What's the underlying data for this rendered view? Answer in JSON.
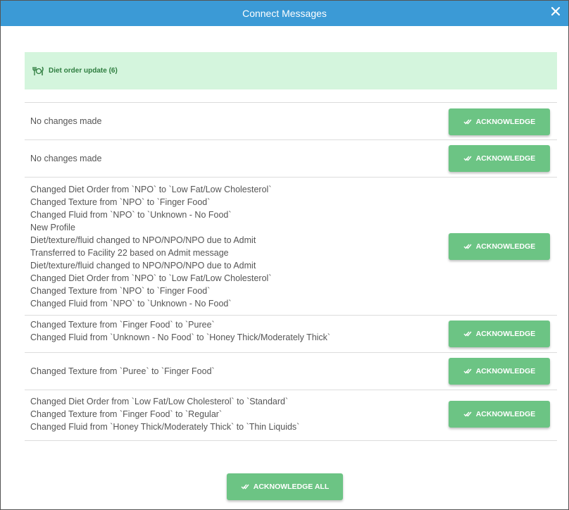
{
  "window": {
    "title": "Connect Messages",
    "close_icon": "close-icon"
  },
  "banner": {
    "icon": "utensils-icon",
    "text": "Diet order update (6)"
  },
  "ack_label": "ACKNOWLEDGE",
  "ack_all_label": "ACKNOWLEDGE ALL",
  "colors": {
    "titlebar": "#3b9ad6",
    "banner_bg": "#d4f5dd",
    "button": "#6cc484"
  },
  "messages": [
    {
      "lines": [
        "No changes made"
      ]
    },
    {
      "lines": [
        "No changes made"
      ]
    },
    {
      "lines": [
        "Changed Diet Order from `NPO` to `Low Fat/Low Cholesterol`",
        "Changed Texture from `NPO` to `Finger Food`",
        "Changed Fluid from `NPO` to `Unknown - No Food`",
        "New Profile",
        "Diet/texture/fluid changed to NPO/NPO/NPO due to Admit",
        "Transferred to Facility 22 based on Admit message",
        "Diet/texture/fluid changed to NPO/NPO/NPO due to Admit",
        "Changed Diet Order from `NPO` to `Low Fat/Low Cholesterol`",
        "Changed Texture from `NPO` to `Finger Food`",
        "Changed Fluid from `NPO` to `Unknown - No Food`"
      ]
    },
    {
      "lines": [
        "Changed Texture from `Finger Food` to `Puree`",
        "Changed Fluid from `Unknown - No Food` to `Honey Thick/Moderately Thick`"
      ]
    },
    {
      "lines": [
        "Changed Texture from `Puree` to `Finger Food`"
      ]
    },
    {
      "lines": [
        "Changed Diet Order from `Low Fat/Low Cholesterol` to `Standard`",
        "Changed Texture from `Finger Food` to `Regular`",
        "Changed Fluid from `Honey Thick/Moderately Thick` to `Thin Liquids`"
      ]
    }
  ]
}
